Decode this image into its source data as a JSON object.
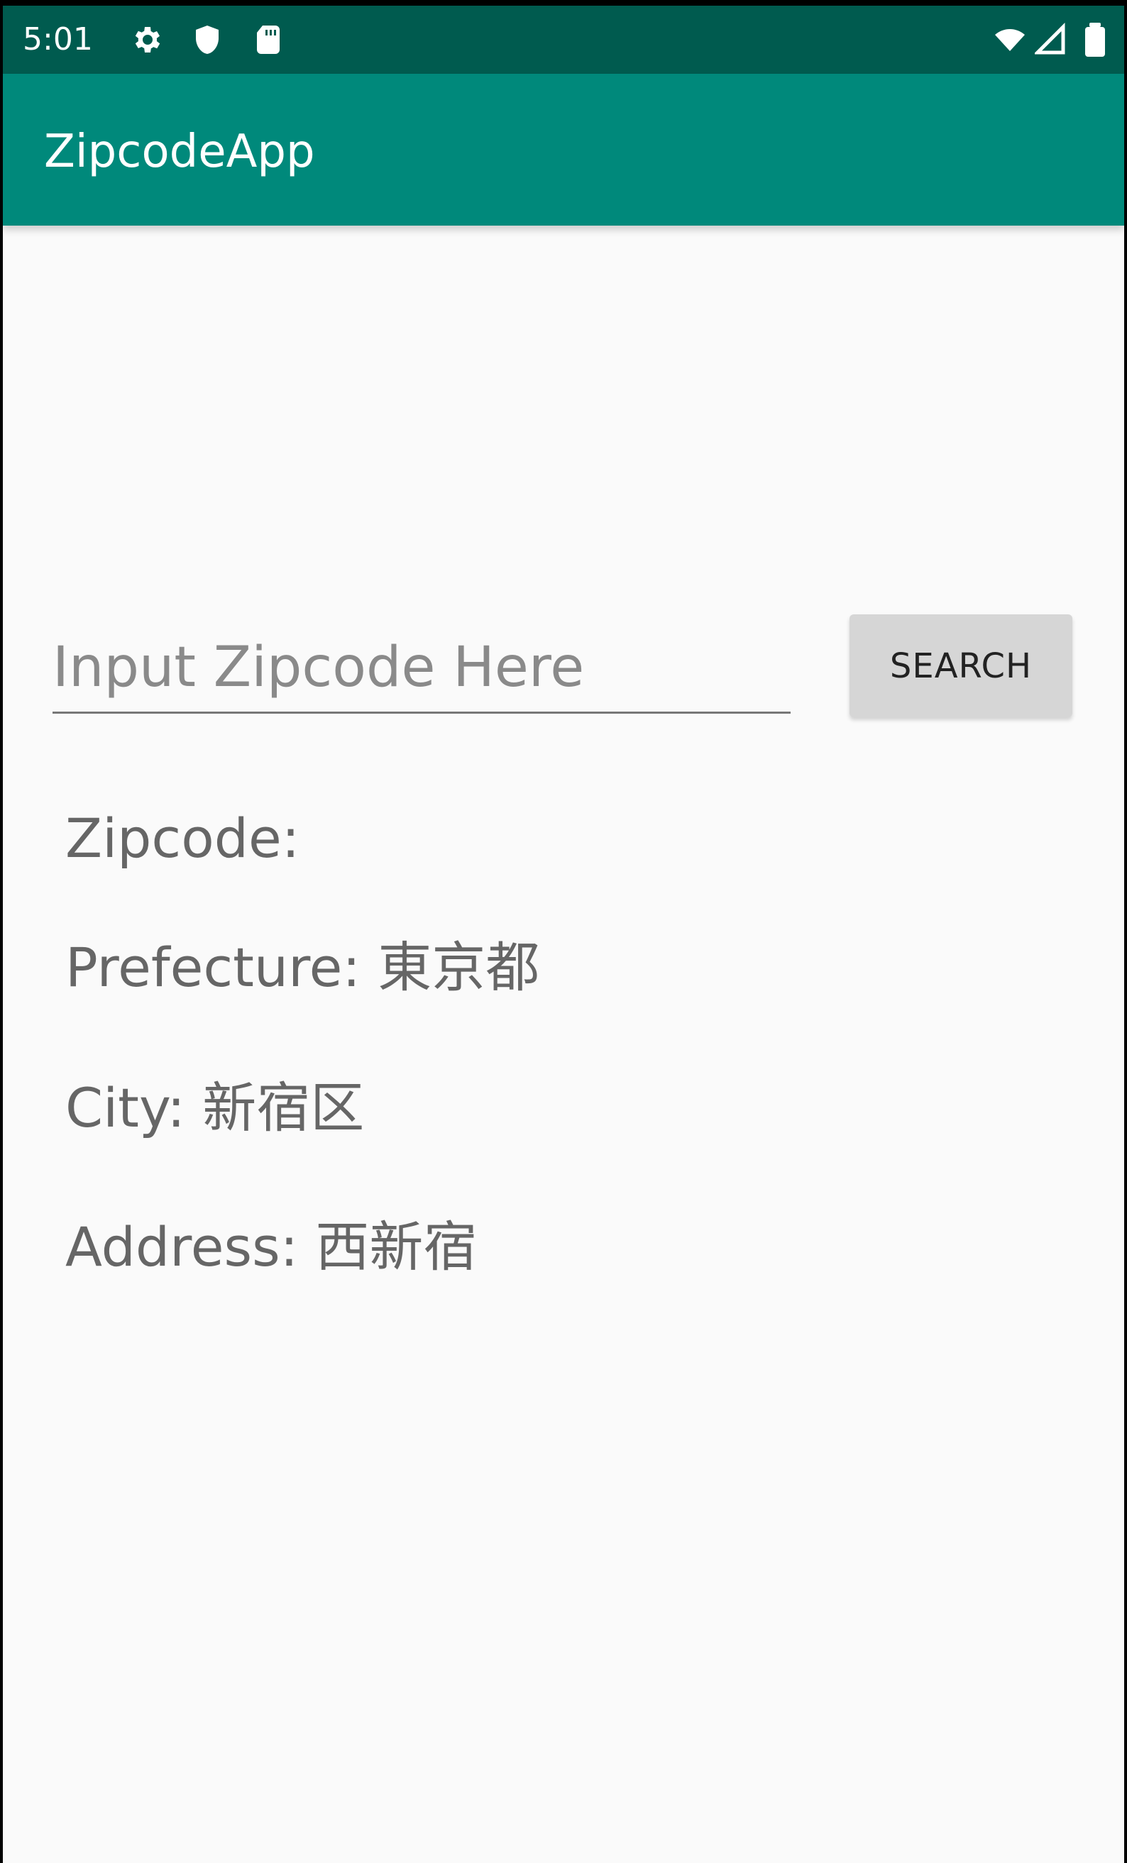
{
  "status_bar": {
    "time": "5:01",
    "left_icons": [
      "gear-icon",
      "shield-icon",
      "sd-card-icon"
    ],
    "right_icons": [
      "wifi-icon",
      "signal-icon",
      "battery-icon"
    ]
  },
  "app_bar": {
    "title": "ZipcodeApp"
  },
  "search": {
    "placeholder": "Input Zipcode Here",
    "value": "",
    "button_label": "SEARCH"
  },
  "results": {
    "zipcode_label": "Zipcode:",
    "prefecture_text": "Prefecture: 東京都",
    "city_text": "City: 新宿区",
    "address_text": "Address: 西新宿"
  },
  "colors": {
    "status_bar": "#005b4f",
    "app_bar": "#00897b",
    "background": "#fafafa",
    "button": "#d6d6d6"
  }
}
